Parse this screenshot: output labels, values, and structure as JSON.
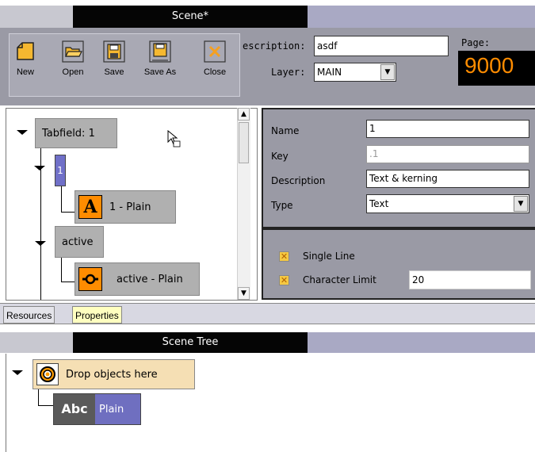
{
  "scene_title": "Scene*",
  "toolbar": {
    "new_label": "New",
    "open_label": "Open",
    "save_label": "Save",
    "saveas_label": "Save As",
    "close_label": "Close"
  },
  "description": {
    "label": "escription:",
    "value": "asdf"
  },
  "layer": {
    "label": "Layer:",
    "value": "MAIN"
  },
  "page": {
    "label": "Page:",
    "value": "9000"
  },
  "tree": {
    "root_label": "Tabfield: 1",
    "item1_label": "1",
    "item1_child_icon_letter": "A",
    "item1_child_label": "1 - Plain",
    "item2_label": "active",
    "item2_child_label": "active - Plain"
  },
  "properties": {
    "name_label": "Name",
    "name_value": "1",
    "key_label": "Key",
    "key_value": ".1",
    "description_label": "Description",
    "description_value": "Text & kerning",
    "type_label": "Type",
    "type_value": "Text"
  },
  "options": {
    "single_line_label": "Single Line",
    "char_limit_label": "Character Limit",
    "char_limit_value": "20",
    "check_glyph": "✕"
  },
  "tabs": {
    "resources": "Resources",
    "properties": "Properties"
  },
  "scene_tree": {
    "title": "Scene Tree",
    "drop_label": "Drop objects here",
    "abc_text": "Abc",
    "plain_label": "Plain"
  },
  "colors": {
    "page_orange": "#ff8c00",
    "tab_active": "#ffffc0"
  }
}
